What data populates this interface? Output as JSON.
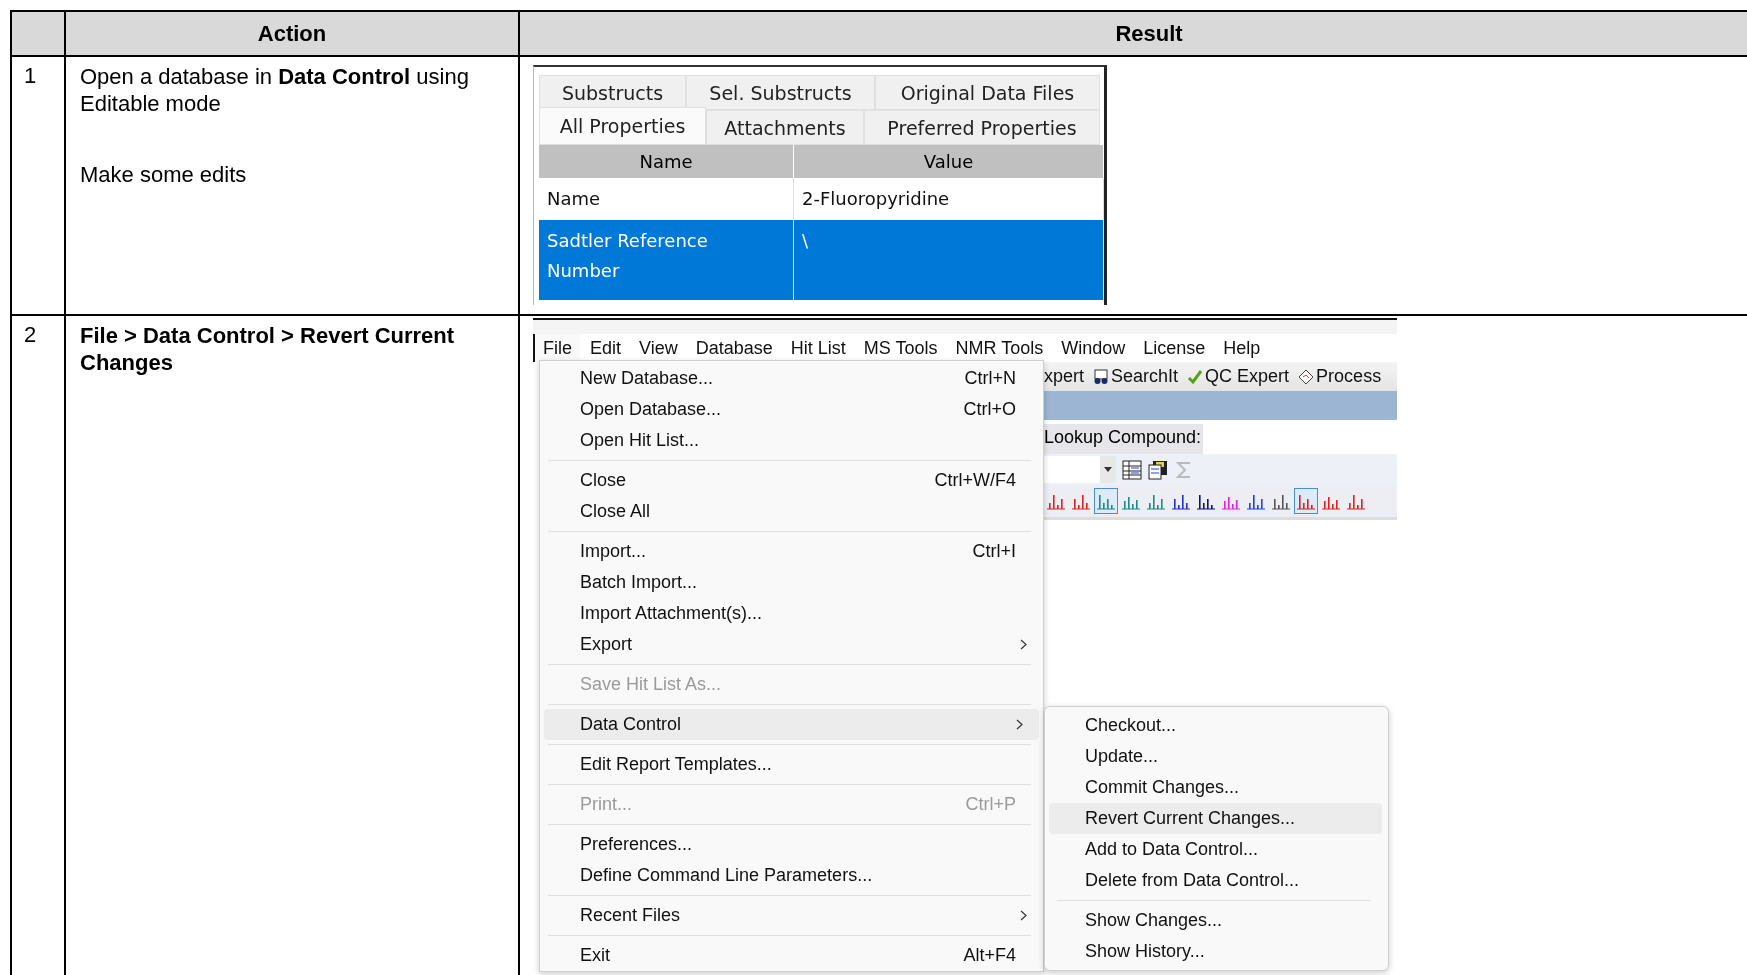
{
  "table": {
    "columns": [
      {
        "label": "Action"
      },
      {
        "label": "Result"
      }
    ],
    "steps": [
      {
        "number": "1",
        "action_bold": false,
        "action": [
          "Open a database in **Data Control** using Editable mode",
          "Make some edits"
        ],
        "result": {
          "kind": "properties",
          "tab_rows": [
            [
              {
                "label": "Substructs",
                "selected": false
              },
              {
                "label": "Sel. Substructs",
                "selected": false
              },
              {
                "label": "Original Data Files",
                "selected": false
              }
            ],
            [
              {
                "label": "All Properties",
                "selected": true
              },
              {
                "label": "Attachments",
                "selected": false
              },
              {
                "label": "Preferred Properties",
                "selected": false
              }
            ]
          ],
          "grid": {
            "columns": [
              "Name",
              "Value"
            ],
            "rows": [
              {
                "name": "Name",
                "value": "2-Fluoropyridine",
                "selected": false
              },
              {
                "name": "Sadtler Reference Number",
                "value": "\\",
                "selected": true
              }
            ]
          }
        }
      },
      {
        "number": "2",
        "action_bold": true,
        "action": [
          "File > Data Control > Revert Current Changes"
        ],
        "result": {
          "kind": "menu",
          "menubar": [
            {
              "label": "File",
              "selected": true
            },
            {
              "label": "Edit",
              "selected": false
            },
            {
              "label": "View",
              "selected": false
            },
            {
              "label": "Database",
              "selected": false
            },
            {
              "label": "Hit List",
              "selected": false
            },
            {
              "label": "MS Tools",
              "selected": false
            },
            {
              "label": "NMR Tools",
              "selected": false
            },
            {
              "label": "Window",
              "selected": false
            },
            {
              "label": "License",
              "selected": false
            },
            {
              "label": "Help",
              "selected": false
            }
          ],
          "toolbar": [
            {
              "label": "xpert"
            },
            {
              "label": "SearchIt"
            },
            {
              "label": "QC Expert"
            },
            {
              "label": "Process"
            }
          ],
          "lookup_label": "Lookup Compound:",
          "view_buttons": [
            {
              "selected": false
            },
            {
              "selected": false
            },
            {
              "selected": true
            },
            {
              "selected": false
            },
            {
              "selected": false
            },
            {
              "selected": false
            },
            {
              "selected": false
            },
            {
              "selected": false
            },
            {
              "selected": false
            },
            {
              "selected": false
            },
            {
              "selected": true
            },
            {
              "selected": false
            },
            {
              "selected": false
            }
          ],
          "file_menu": [
            {
              "kind": "item",
              "label": "New Database...",
              "shortcut": "Ctrl+N",
              "disabled": false,
              "submenu": false,
              "selected": false
            },
            {
              "kind": "item",
              "label": "Open Database...",
              "shortcut": "Ctrl+O",
              "disabled": false,
              "submenu": false,
              "selected": false
            },
            {
              "kind": "item",
              "label": "Open Hit List...",
              "disabled": false,
              "submenu": false,
              "selected": false
            },
            {
              "kind": "separator"
            },
            {
              "kind": "item",
              "label": "Close",
              "shortcut": "Ctrl+W/F4",
              "disabled": false,
              "submenu": false,
              "selected": false
            },
            {
              "kind": "item",
              "label": "Close All",
              "disabled": false,
              "submenu": false,
              "selected": false
            },
            {
              "kind": "separator"
            },
            {
              "kind": "item",
              "label": "Import...",
              "shortcut": "Ctrl+I",
              "disabled": false,
              "submenu": false,
              "selected": false
            },
            {
              "kind": "item",
              "label": "Batch Import...",
              "disabled": false,
              "submenu": false,
              "selected": false
            },
            {
              "kind": "item",
              "label": "Import Attachment(s)...",
              "disabled": false,
              "submenu": false,
              "selected": false
            },
            {
              "kind": "item",
              "label": "Export",
              "disabled": false,
              "submenu": true,
              "selected": false
            },
            {
              "kind": "separator"
            },
            {
              "kind": "item",
              "label": "Save Hit List As...",
              "disabled": true,
              "submenu": false,
              "selected": false
            },
            {
              "kind": "separator"
            },
            {
              "kind": "item",
              "label": "Data Control",
              "disabled": false,
              "submenu": true,
              "selected": true
            },
            {
              "kind": "separator"
            },
            {
              "kind": "item",
              "label": "Edit Report Templates...",
              "disabled": false,
              "submenu": false,
              "selected": false
            },
            {
              "kind": "separator"
            },
            {
              "kind": "item",
              "label": "Print...",
              "shortcut": "Ctrl+P",
              "disabled": true,
              "submenu": false,
              "selected": false
            },
            {
              "kind": "separator"
            },
            {
              "kind": "item",
              "label": "Preferences...",
              "disabled": false,
              "submenu": false,
              "selected": false
            },
            {
              "kind": "item",
              "label": "Define Command Line Parameters...",
              "disabled": false,
              "submenu": false,
              "selected": false
            },
            {
              "kind": "separator"
            },
            {
              "kind": "item",
              "label": "Recent Files",
              "disabled": false,
              "submenu": true,
              "selected": false
            },
            {
              "kind": "separator"
            },
            {
              "kind": "item",
              "label": "Exit",
              "shortcut": "Alt+F4",
              "disabled": false,
              "submenu": false,
              "selected": false
            }
          ],
          "submenu": [
            {
              "kind": "item",
              "label": "Checkout...",
              "selected": false
            },
            {
              "kind": "item",
              "label": "Update...",
              "selected": false
            },
            {
              "kind": "item",
              "label": "Commit Changes...",
              "selected": false
            },
            {
              "kind": "item",
              "label": "Revert Current Changes...",
              "selected": true
            },
            {
              "kind": "item",
              "label": "Add to Data Control...",
              "selected": false
            },
            {
              "kind": "item",
              "label": "Delete from Data Control...",
              "selected": false
            },
            {
              "kind": "separator"
            },
            {
              "kind": "item",
              "label": "Show Changes...",
              "selected": false
            },
            {
              "kind": "item",
              "label": "Show History...",
              "selected": false
            }
          ]
        }
      }
    ]
  }
}
